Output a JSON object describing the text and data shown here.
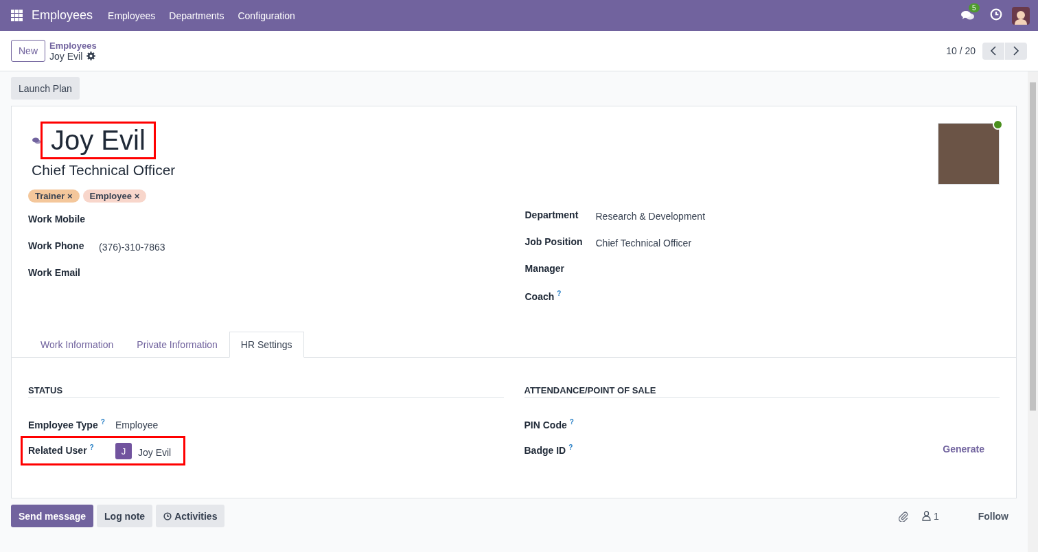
{
  "navbar": {
    "app_name": "Employees",
    "menu": [
      "Employees",
      "Departments",
      "Configuration"
    ],
    "messages_badge": "5"
  },
  "control_panel": {
    "new_button": "New",
    "breadcrumb_parent": "Employees",
    "breadcrumb_current": "Joy Evil",
    "pager": "10 / 20"
  },
  "action_buttons": [
    "Launch Plan"
  ],
  "form": {
    "name": "Joy Evil",
    "name_highlighted": true,
    "job_title": "Chief Technical Officer",
    "online": true,
    "tags": [
      {
        "label": "Trainer",
        "remove": "×",
        "color": "#f4c79b"
      },
      {
        "label": "Employee",
        "remove": "×",
        "color": "#f8d6cb"
      }
    ],
    "left_fields": [
      {
        "label": "Work Mobile"
      },
      {
        "label": "Work Phone",
        "value": "(376)-310-7863"
      },
      {
        "label": "Work Email"
      }
    ],
    "right_fields": [
      {
        "label": "Department",
        "value": "Research & Development"
      },
      {
        "label": "Job Position",
        "value": "Chief Technical Officer"
      },
      {
        "label": "Manager"
      },
      {
        "label": "Coach",
        "help": "?"
      }
    ],
    "tabs": [
      {
        "label": "Work Information",
        "selected": false
      },
      {
        "label": "Private Information",
        "selected": false
      },
      {
        "label": "HR Settings",
        "selected": true
      }
    ],
    "sections": [
      {
        "title": "STATUS",
        "fields": [
          {
            "kind": "text",
            "label": "Employee Type",
            "help": "?",
            "value": "Employee",
            "highlighted": false
          },
          {
            "kind": "user",
            "label": "Related User",
            "help": "?",
            "avatar_letter": "J",
            "value": "Joy Evil",
            "highlighted": true
          }
        ]
      },
      {
        "title": "ATTENDANCE/POINT OF SALE",
        "fields": [
          {
            "kind": "text",
            "label": "PIN Code",
            "help": "?",
            "highlighted": false
          },
          {
            "kind": "action",
            "label": "Badge ID",
            "help": "?",
            "action": "Generate",
            "highlighted": false
          }
        ]
      }
    ]
  },
  "chatter": {
    "buttons": [
      {
        "label": "Send message",
        "primary": true,
        "icon": false
      },
      {
        "label": "Log note",
        "primary": false,
        "icon": false
      },
      {
        "label": "Activities",
        "primary": false,
        "icon": true
      }
    ],
    "followers": "1",
    "follow": "Follow"
  }
}
